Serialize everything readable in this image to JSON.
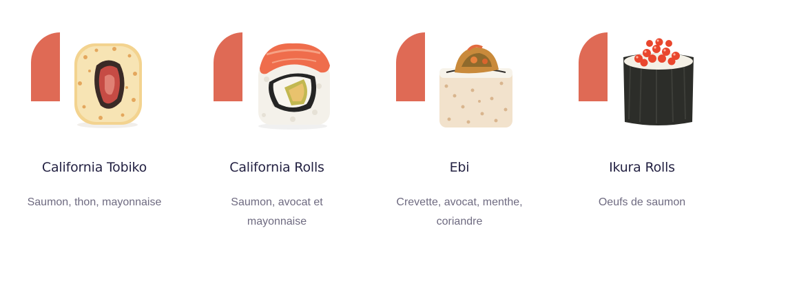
{
  "theme": {
    "accent": "#df6a55",
    "title_color": "#232142",
    "text_color": "#6e6a80"
  },
  "items": [
    {
      "name": "California Tobiko",
      "description": "Saumon, thon, mayonnaise",
      "image": "sushi-california-tobiko"
    },
    {
      "name": "California Rolls",
      "description": "Saumon, avocat et mayonnaise",
      "image": "sushi-california-rolls"
    },
    {
      "name": "Ebi",
      "description": "Crevette, avocat, menthe, coriandre",
      "image": "sushi-ebi"
    },
    {
      "name": "Ikura Rolls",
      "description": "Oeufs de saumon",
      "image": "sushi-ikura-rolls"
    }
  ]
}
